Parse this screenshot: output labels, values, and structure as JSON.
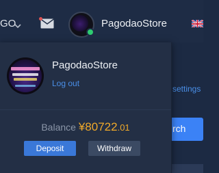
{
  "header": {
    "language_label": "GO",
    "store_name": "PagodaoStore"
  },
  "background": {
    "settings_link": "settings",
    "search_button": "rch"
  },
  "account_panel": {
    "name": "PagodaoStore",
    "logout_label": "Log out",
    "balance_label": "Balance",
    "currency_symbol": "¥",
    "balance_main": "80722",
    "balance_cents": ".01",
    "deposit_label": "Deposit",
    "withdraw_label": "Withdraw"
  },
  "colors": {
    "accent": "#4a8fe8",
    "balance": "#f0a92a",
    "deposit": "#3a78d8",
    "withdraw": "#3b4a63",
    "panel": "#232f45"
  }
}
